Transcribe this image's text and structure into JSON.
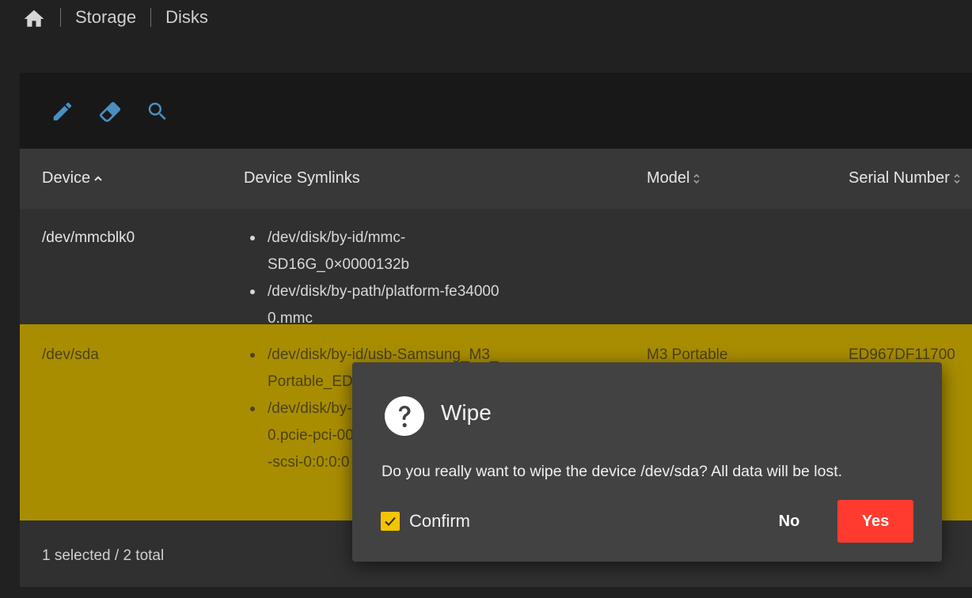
{
  "breadcrumb": {
    "home_icon": "home-icon",
    "items": [
      "Storage",
      "Disks"
    ]
  },
  "toolbar": {
    "icons": [
      "pencil-icon",
      "eraser-icon",
      "search-icon"
    ],
    "icon_color": "#4a8fc0"
  },
  "table": {
    "columns": {
      "device": "Device",
      "symlinks": "Device Symlinks",
      "model": "Model",
      "serial": "Serial Number"
    },
    "rows": [
      {
        "device": "/dev/mmcblk0",
        "symlinks": [
          "/dev/disk/by-id/mmc-SD16G_0×0000132b",
          "/dev/disk/by-path/platform-fe340000.mmc"
        ],
        "model": "",
        "serial": "",
        "selected": false
      },
      {
        "device": "/dev/sda",
        "symlinks": [
          "/dev/disk/by-id/usb-Samsung_M3_Portable_ED967DF11700-0:0",
          "/dev/disk/by-path/platform-fd500000.pcie-pci-0000:01:00.0-usb-0:1:1.0-scsi-0:0:0:0"
        ],
        "model": "M3 Portable",
        "serial": "ED967DF11700",
        "selected": true
      }
    ],
    "selected_color": "#a98d00"
  },
  "footer": {
    "count": "1 selected / 2 total"
  },
  "dialog": {
    "icon": "question-circle-icon",
    "title": "Wipe",
    "message": "Do you really want to wipe the device /dev/sda? All data will be lost.",
    "confirm_label": "Confirm",
    "confirm_checked": true,
    "no_label": "No",
    "yes_label": "Yes",
    "yes_color": "#ff3b2f"
  }
}
